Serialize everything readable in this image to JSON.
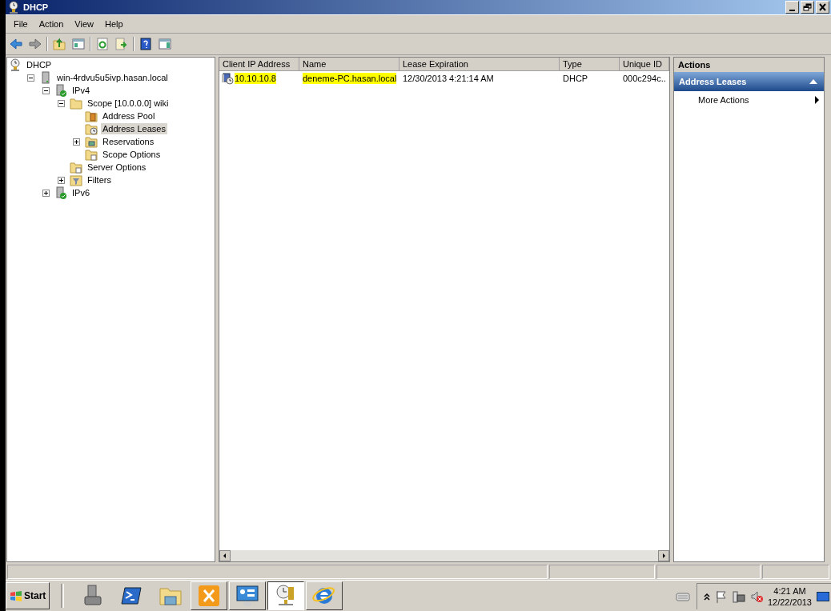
{
  "window": {
    "title": "DHCP"
  },
  "menu": [
    "File",
    "Action",
    "View",
    "Help"
  ],
  "tree": [
    {
      "label": "DHCP",
      "kind": "dhcp",
      "selected": false,
      "children": [
        {
          "label": "win-4rdvu5u5ivp.hasan.local",
          "kind": "server",
          "expanded": true,
          "selected": false,
          "children": [
            {
              "label": "IPv4",
              "kind": "ip",
              "expanded": true,
              "selected": false,
              "children": [
                {
                  "label": "Scope [10.0.0.0] wiki",
                  "kind": "folder",
                  "expanded": true,
                  "selected": false,
                  "children": [
                    {
                      "label": "Address Pool",
                      "kind": "pool",
                      "selected": false
                    },
                    {
                      "label": "Address Leases",
                      "kind": "leases",
                      "selected": true
                    },
                    {
                      "label": "Reservations",
                      "kind": "reserv",
                      "expanded": false,
                      "selected": false
                    },
                    {
                      "label": "Scope Options",
                      "kind": "options",
                      "selected": false
                    }
                  ]
                },
                {
                  "label": "Server Options",
                  "kind": "options",
                  "selected": false
                },
                {
                  "label": "Filters",
                  "kind": "filter",
                  "expanded": false,
                  "selected": false
                }
              ]
            },
            {
              "label": "IPv6",
              "kind": "ip",
              "expanded": false,
              "selected": false
            }
          ]
        }
      ]
    }
  ],
  "table": {
    "columns": [
      "Client IP Address",
      "Name",
      "Lease Expiration",
      "Type",
      "Unique ID"
    ],
    "rows": [
      {
        "cells": [
          {
            "text": "10.10.10.8",
            "highlighted": true
          },
          {
            "text": "deneme-PC.hasan.local",
            "highlighted": true
          },
          {
            "text": "12/30/2013 4:21:14 AM",
            "highlighted": false
          },
          {
            "text": "DHCP",
            "highlighted": false
          },
          {
            "text": "000c294c..",
            "highlighted": false
          }
        ]
      }
    ]
  },
  "actions": {
    "title": "Actions",
    "section": "Address Leases",
    "items": [
      "More Actions"
    ]
  },
  "taskbar": {
    "start": "Start",
    "apps": [
      {
        "kind": "toolbox",
        "active": false
      },
      {
        "kind": "powershell",
        "active": false
      },
      {
        "kind": "explorer",
        "active": false
      },
      {
        "kind": "exchange",
        "active": false
      },
      {
        "kind": "panel",
        "active": false
      },
      {
        "kind": "dhcp",
        "active": true
      },
      {
        "kind": "ie",
        "active": false
      }
    ],
    "time": "4:21 AM",
    "date": "12/22/2013"
  }
}
